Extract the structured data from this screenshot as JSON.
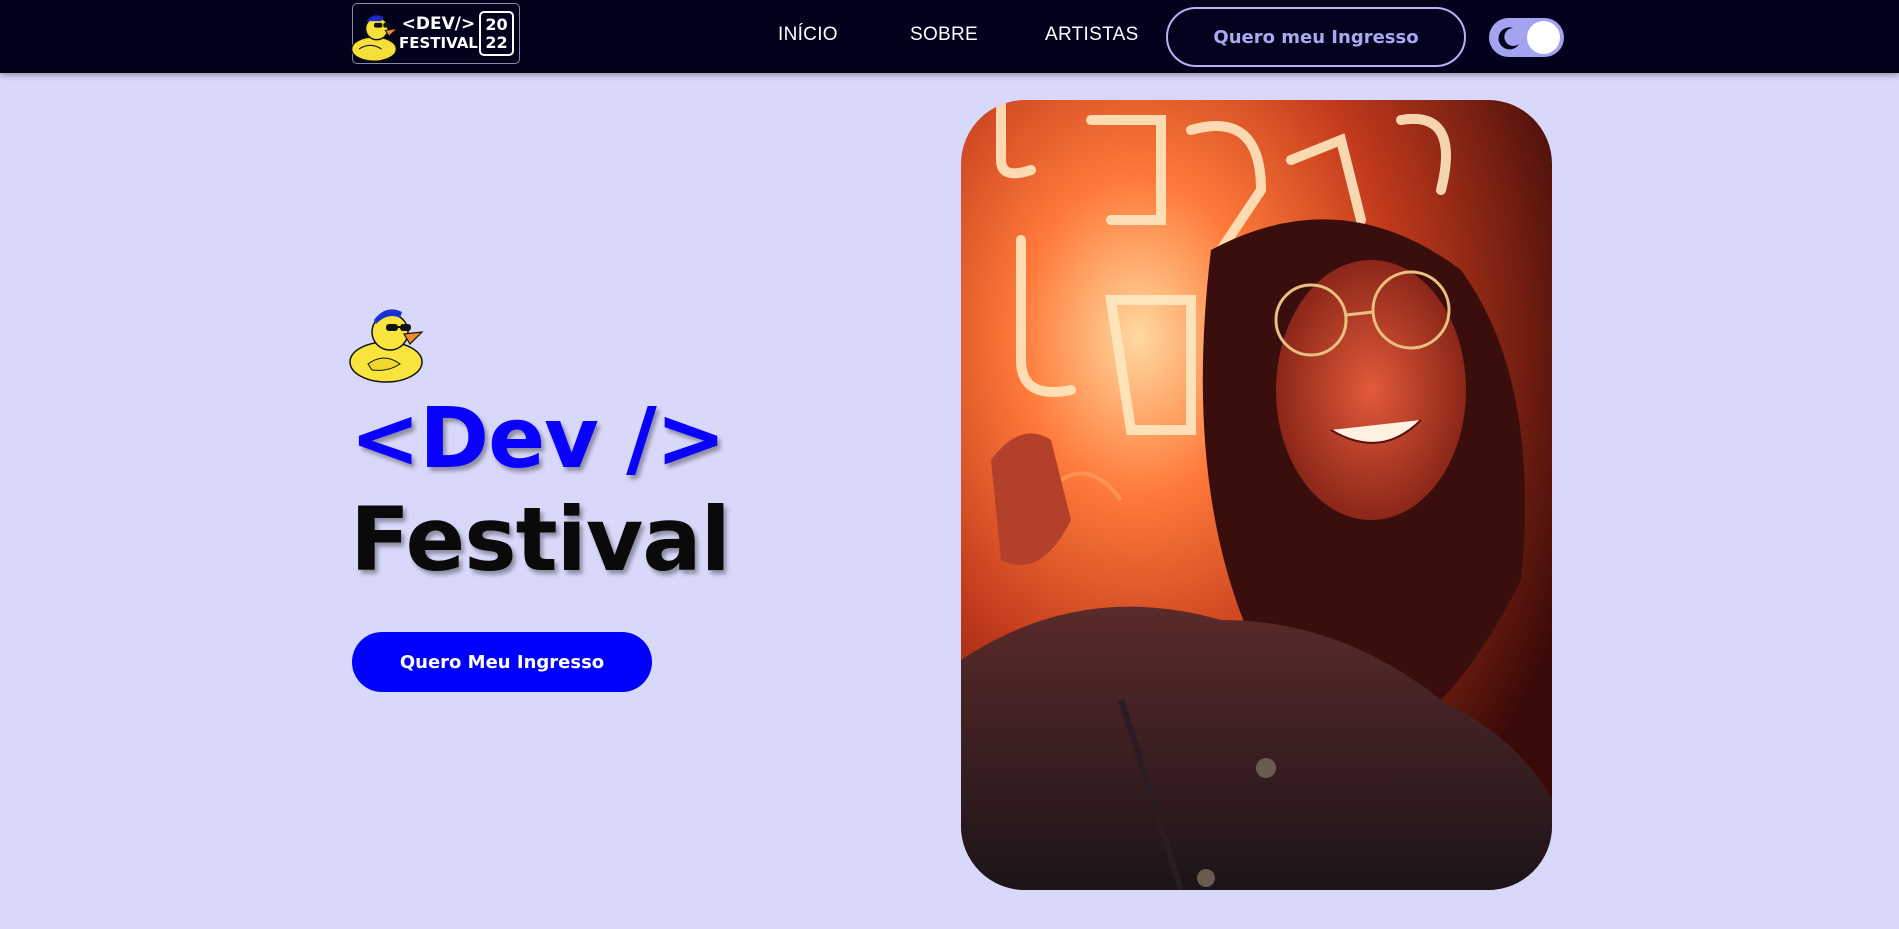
{
  "header": {
    "logo": {
      "line1": "<DEV/>",
      "line2": "FESTIVAL",
      "year_top": "20",
      "year_bottom": "22"
    },
    "nav": [
      {
        "label": "INÍCIO"
      },
      {
        "label": "SOBRE"
      },
      {
        "label": "ARTISTAS"
      }
    ],
    "cta_label": "Quero meu Ingresso",
    "theme_toggle": {
      "icon": "moon-icon",
      "state": "dark-mode-off"
    }
  },
  "hero": {
    "title_line1": "<Dev />",
    "title_line2": "Festival",
    "cta_label": "Quero Meu Ingresso",
    "image": "woman-neon-light-photo"
  },
  "colors": {
    "background": "#d8d8fa",
    "header_bg": "#02021d",
    "accent_blue": "#0000ff",
    "toggle_bg": "#a3a3f0",
    "cta_outline": "#b3b3f5"
  }
}
